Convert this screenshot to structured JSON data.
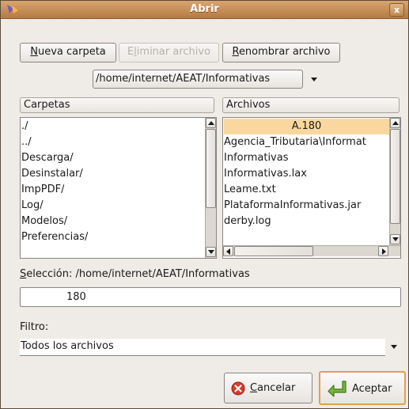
{
  "window": {
    "title": "Abrir",
    "close_glyph": "x"
  },
  "toolbar": {
    "new_folder": {
      "prefix": "",
      "mnemonic": "N",
      "rest": "ueva carpeta"
    },
    "delete_file": {
      "prefix": "E",
      "mnemonic": "l",
      "rest": "iminar archivo",
      "disabled": true
    },
    "rename_file": {
      "prefix": "",
      "mnemonic": "R",
      "rest": "enombrar archivo"
    }
  },
  "path": {
    "current": "/home/internet/AEAT/Informativas"
  },
  "folders": {
    "header": "Carpetas",
    "items": [
      "./",
      "../",
      "Descarga/",
      "Desinstalar/",
      "ImpPDF/",
      "Log/",
      "Modelos/",
      "Preferencias/"
    ]
  },
  "files": {
    "header": "Archivos",
    "items": [
      "A.180",
      "Agencia_Tributaria\\Informat",
      "Informativas",
      "Informativas.lax",
      "Leame.txt",
      "PlataformaInformativas.jar",
      "derby.log"
    ],
    "selected_index": 0
  },
  "selection": {
    "label_mnemonic": "S",
    "label_rest": "elección: /home/internet/AEAT/Informativas",
    "value": "180"
  },
  "filter": {
    "label": "Filtro:",
    "value": "Todos los archivos"
  },
  "buttons": {
    "cancel": {
      "mnemonic": "C",
      "rest": "ancelar"
    },
    "accept": {
      "label": "Aceptar"
    }
  },
  "icons": {
    "app": "app-icon",
    "cancel": "cancel-icon",
    "accept": "enter-arrow-icon"
  },
  "colors": {
    "titlebar": "#c58c55",
    "selection": "#f9d79e",
    "default_button_border": "#e0a050"
  }
}
